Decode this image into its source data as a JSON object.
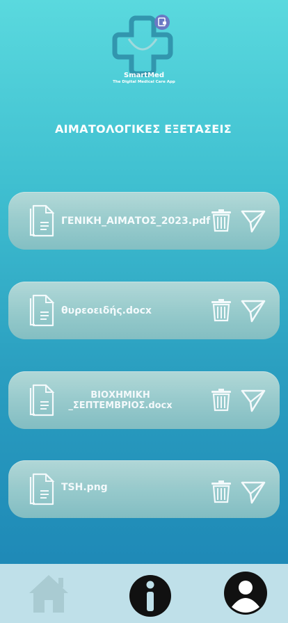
{
  "app": {
    "name": "SmartMed",
    "tagline": "The Digital Medical Care App"
  },
  "page": {
    "title": "ΑΙΜΑΤΟΛΟΓΙΚΕΣ ΕΞΕΤΑΣΕΙΣ"
  },
  "files": [
    {
      "name": "ΓΕΝΙΚΗ_ΑΙΜΑΤΟΣ_2023.pdf"
    },
    {
      "name": "θυρεοειδής.docx"
    },
    {
      "name_line1": "ΒΙΟΧΗΜΙΚΗ",
      "name_line2": "_ΣΕΠΤΕΜΒΡΙΟΣ.docx"
    },
    {
      "name": "TSH.png"
    }
  ],
  "nav": {
    "items": [
      "home-icon",
      "info-icon",
      "profile-icon"
    ]
  },
  "colors": {
    "bg_top": "#5ad9de",
    "bg_bottom": "#1b83b4",
    "card": "#a4d0cf",
    "nav_bar": "#bfe0e9"
  }
}
